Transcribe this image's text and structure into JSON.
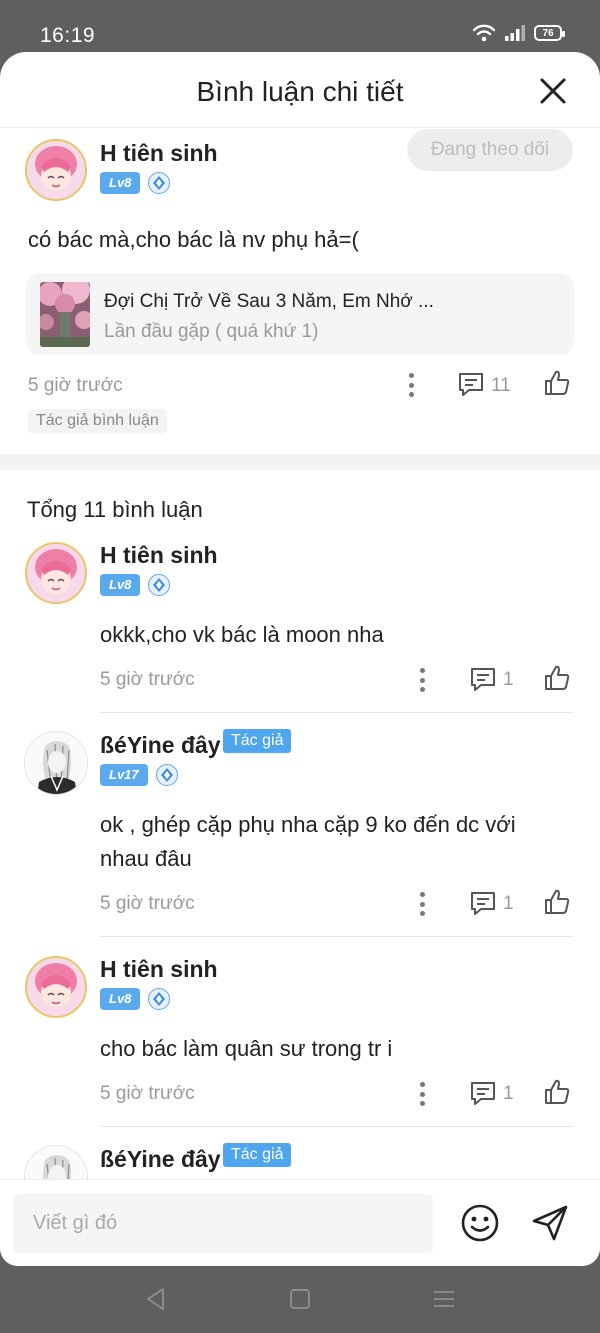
{
  "status": {
    "time": "16:19",
    "battery": "76"
  },
  "header": {
    "title": "Bình luận chi tiết"
  },
  "main_comment": {
    "username": "H tiên sinh",
    "level": "Lv8",
    "follow_label": "Đang theo dõi",
    "text": "có bác mà,cho bác là nv phụ hả=(",
    "book": {
      "title": "Đợi Chị Trở Về Sau 3 Năm, Em Nhớ ...",
      "chapter": "Lần đầu gặp ( quá khứ 1)"
    },
    "time": "5 giờ trước",
    "reply_count": "11",
    "author_comment_tag": "Tác giả bình luận"
  },
  "replies_total": "Tổng 11 bình luận",
  "replies": [
    {
      "username": "H tiên sinh",
      "level": "Lv8",
      "text": "okkk,cho vk bác là moon nha",
      "time": "5 giờ trước",
      "reply_count": "1"
    },
    {
      "username": "ßéYine đây",
      "author_tag": "Tác giả",
      "level": "Lv17",
      "text": "ok , ghép cặp phụ nha cặp 9 ko đến dc với nhau đâu",
      "time": "5 giờ trước",
      "reply_count": "1"
    },
    {
      "username": "H tiên sinh",
      "level": "Lv8",
      "text": "cho bác làm quân sư trong tr i",
      "time": "5 giờ trước",
      "reply_count": "1"
    },
    {
      "username": "ßéYine đây",
      "author_tag": "Tác giả"
    }
  ],
  "input": {
    "placeholder": "Viết gì đó"
  },
  "colors": {
    "accent": "#4ea6ef",
    "level_badge": "#5aa9ec"
  }
}
